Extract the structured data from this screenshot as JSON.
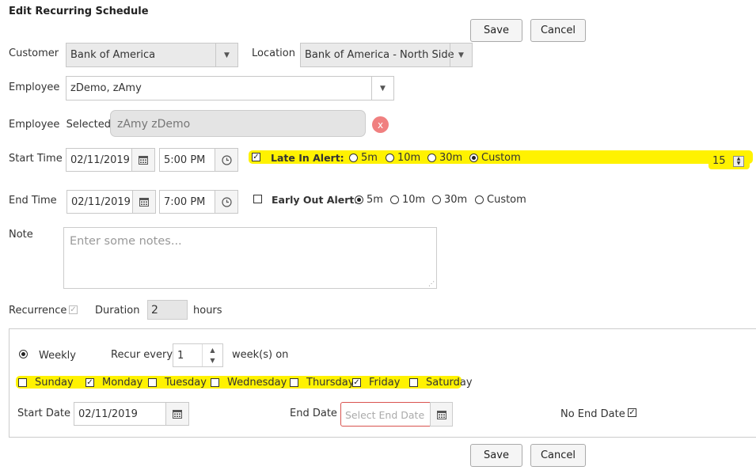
{
  "header": {
    "title": "Edit Recurring Schedule"
  },
  "actions": {
    "save_label": "Save",
    "cancel_label": "Cancel"
  },
  "form": {
    "customer_label": "Customer",
    "customer_value": "Bank of America",
    "location_label": "Location",
    "location_value": "Bank of America - North Side",
    "employee_label": "Employee",
    "employee_value": "zDemo, zAmy",
    "employee_selected_label": "Employee  Selected",
    "employee_selected_tag": "zAmy zDemo",
    "remove_tag_label": "x",
    "start_time_label": "Start Time",
    "start_date": "02/11/2019",
    "start_time": "5:00 PM",
    "end_time_label": "End Time",
    "end_date": "02/11/2019",
    "end_time": "7:00 PM",
    "note_label": "Note",
    "note_placeholder": "Enter some notes...",
    "recurrence_label": "Recurrence",
    "recurrence_checked": true,
    "duration_label": "Duration",
    "duration_value": "2",
    "hours_label": "hours"
  },
  "late_in": {
    "label": "Late In Alert:",
    "checked": true,
    "options": [
      "5m",
      "10m",
      "30m",
      "Custom"
    ],
    "selected": "Custom",
    "custom_value": "15"
  },
  "early_out": {
    "label": "Early Out Alert:",
    "checked": false,
    "options": [
      "5m",
      "10m",
      "30m",
      "Custom"
    ],
    "selected": "5m"
  },
  "recurrence": {
    "weekly_label": "Weekly",
    "recur_every_label": "Recur every",
    "recur_every_value": "1",
    "weeks_on_label": "week(s) on",
    "days": [
      {
        "label": "Sunday",
        "checked": false
      },
      {
        "label": "Monday",
        "checked": true
      },
      {
        "label": "Tuesday",
        "checked": false
      },
      {
        "label": "Wednesday",
        "checked": false
      },
      {
        "label": "Thursday",
        "checked": false
      },
      {
        "label": "Friday",
        "checked": true
      },
      {
        "label": "Saturday",
        "checked": false
      }
    ],
    "start_date_label": "Start Date",
    "start_date_value": "02/11/2019",
    "end_date_label": "End Date",
    "end_date_placeholder": "Select End Date",
    "no_end_date_label": "No End Date",
    "no_end_date_checked": true
  },
  "colors": {
    "highlight": "#fff200",
    "invalid_border": "#d9534f",
    "remove_badge": "#f08080"
  }
}
